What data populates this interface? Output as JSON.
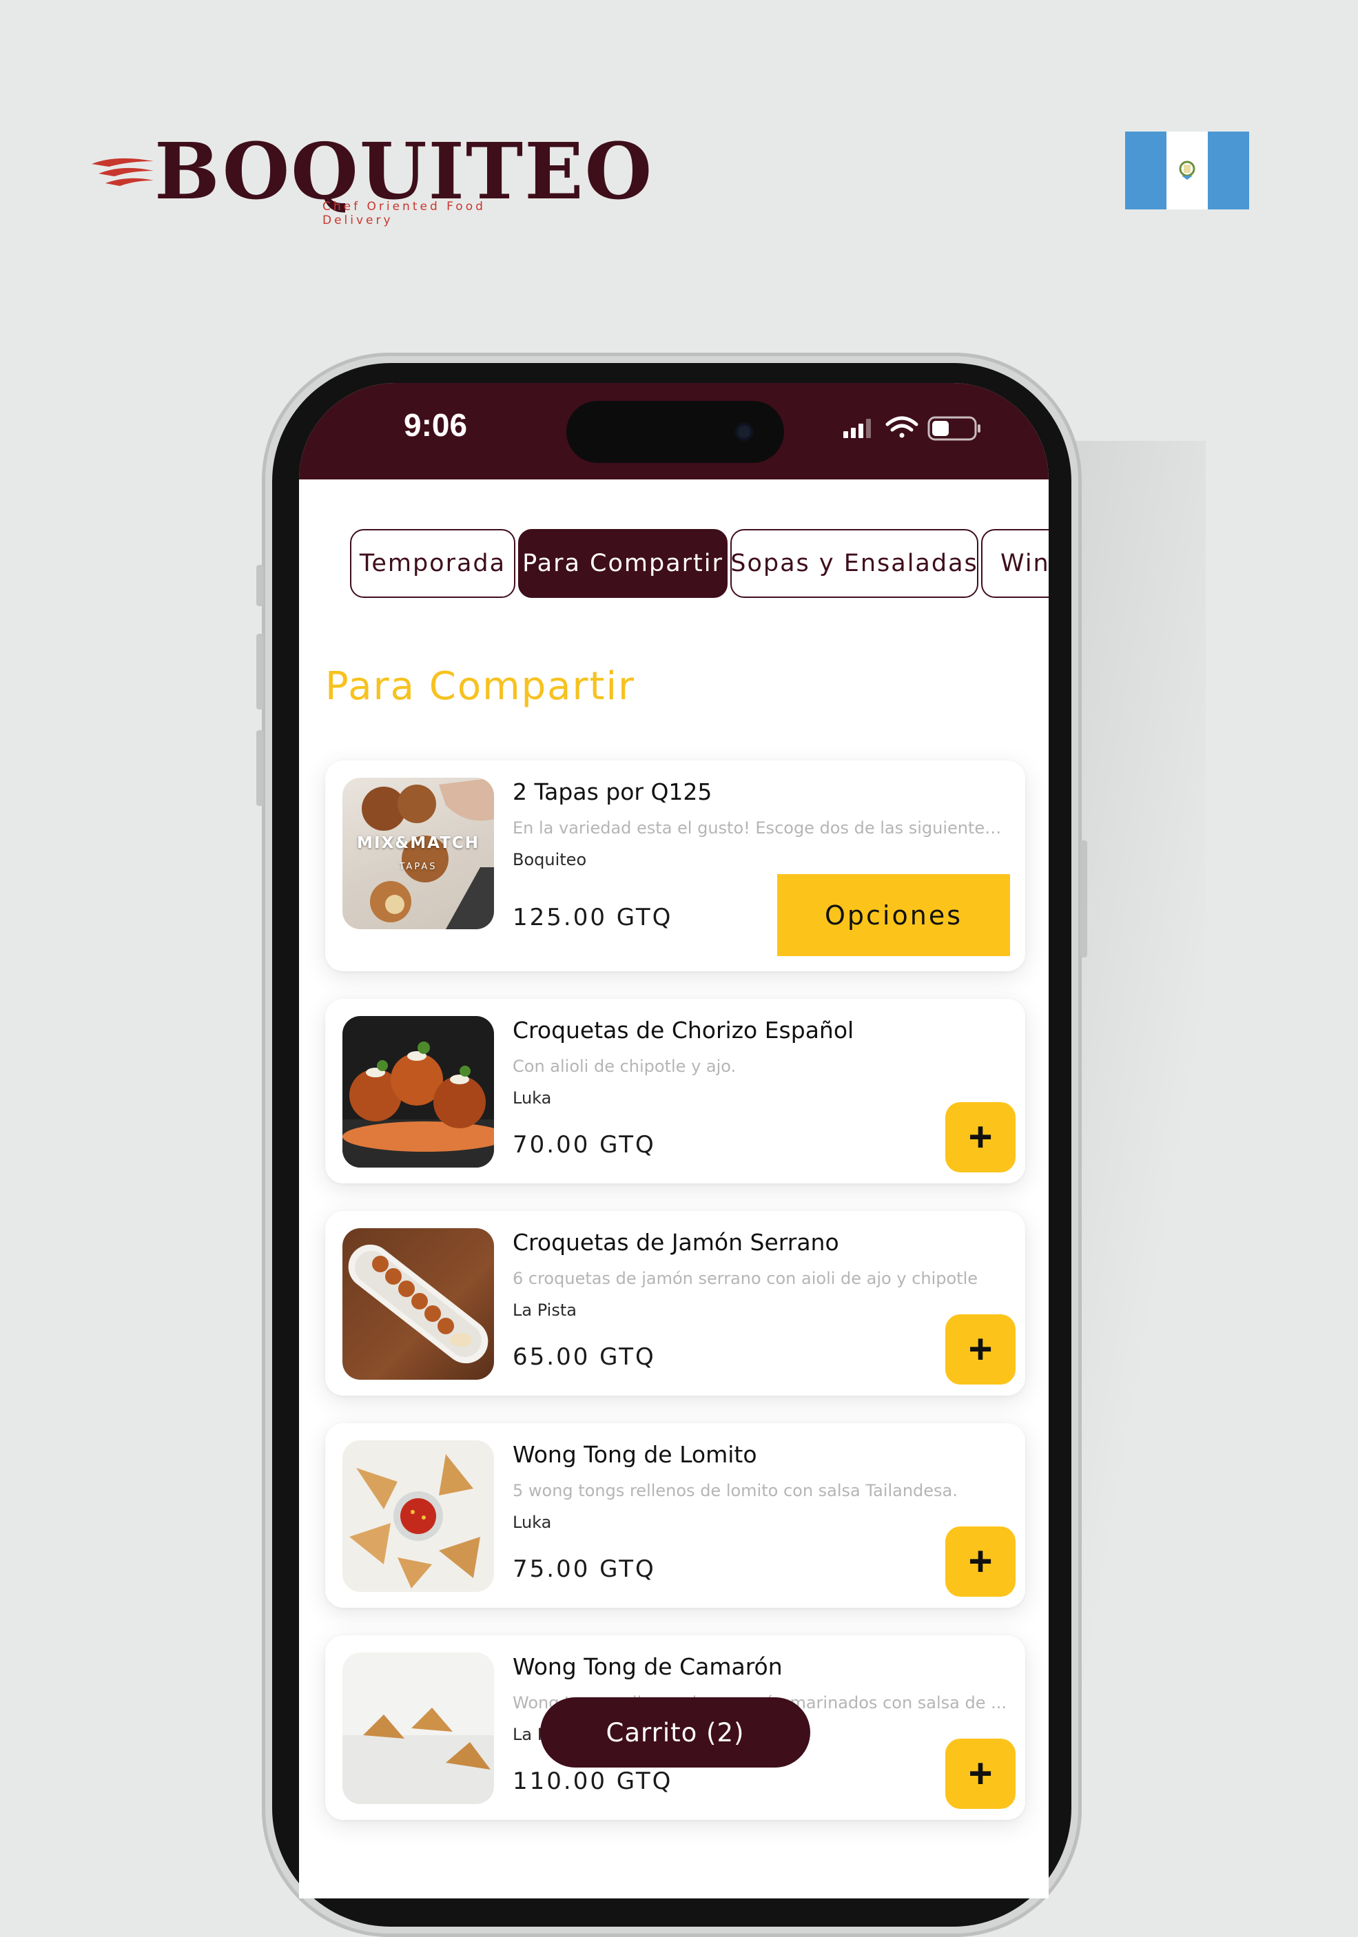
{
  "brand": {
    "name": "BOQUITEO",
    "tagline": "Chef Oriented Food Delivery",
    "color": "#3f0e1b",
    "accent": "#c8372e",
    "flag": "guatemala-flag"
  },
  "status_bar": {
    "time": "9:06",
    "icons": [
      "signal-icon",
      "wifi-icon",
      "battery-icon"
    ]
  },
  "tabs": [
    {
      "label": "Temporada",
      "active": false
    },
    {
      "label": "Para Compartir",
      "active": true
    },
    {
      "label": "Sopas y Ensaladas",
      "active": false
    },
    {
      "label": "Wings",
      "active": false
    }
  ],
  "section_title": "Para Compartir",
  "products": [
    {
      "name": "2 Tapas por Q125",
      "description": "En la variedad esta el gusto! Escoge dos de las siguientes...",
      "vendor": "Boquiteo",
      "price": "125.00 GTQ",
      "action": "Opciones",
      "image_text": "MIX&MATCH",
      "image_subtext": "TAPAS"
    },
    {
      "name": "Croquetas de Chorizo Español",
      "description": "Con alioli de chipotle y ajo.",
      "vendor": "Luka",
      "price": "70.00 GTQ",
      "action": "+"
    },
    {
      "name": "Croquetas de Jamón Serrano",
      "description": "6 croquetas de jamón serrano con aioli de ajo y chipotle",
      "vendor": "La Pista",
      "price": "65.00 GTQ",
      "action": "+"
    },
    {
      "name": "Wong Tong de Lomito",
      "description": "5 wong tongs rellenos de lomito con salsa Tailandesa.",
      "vendor": "Luka",
      "price": "75.00 GTQ",
      "action": "+"
    },
    {
      "name": "Wong Tong de Camarón",
      "description": "Wong tongs rellenos de camarón marinados con salsa de ...",
      "vendor": "La Pista",
      "price": "110.00 GTQ",
      "action": "+"
    }
  ],
  "cart": {
    "label": "Carrito (2)"
  }
}
